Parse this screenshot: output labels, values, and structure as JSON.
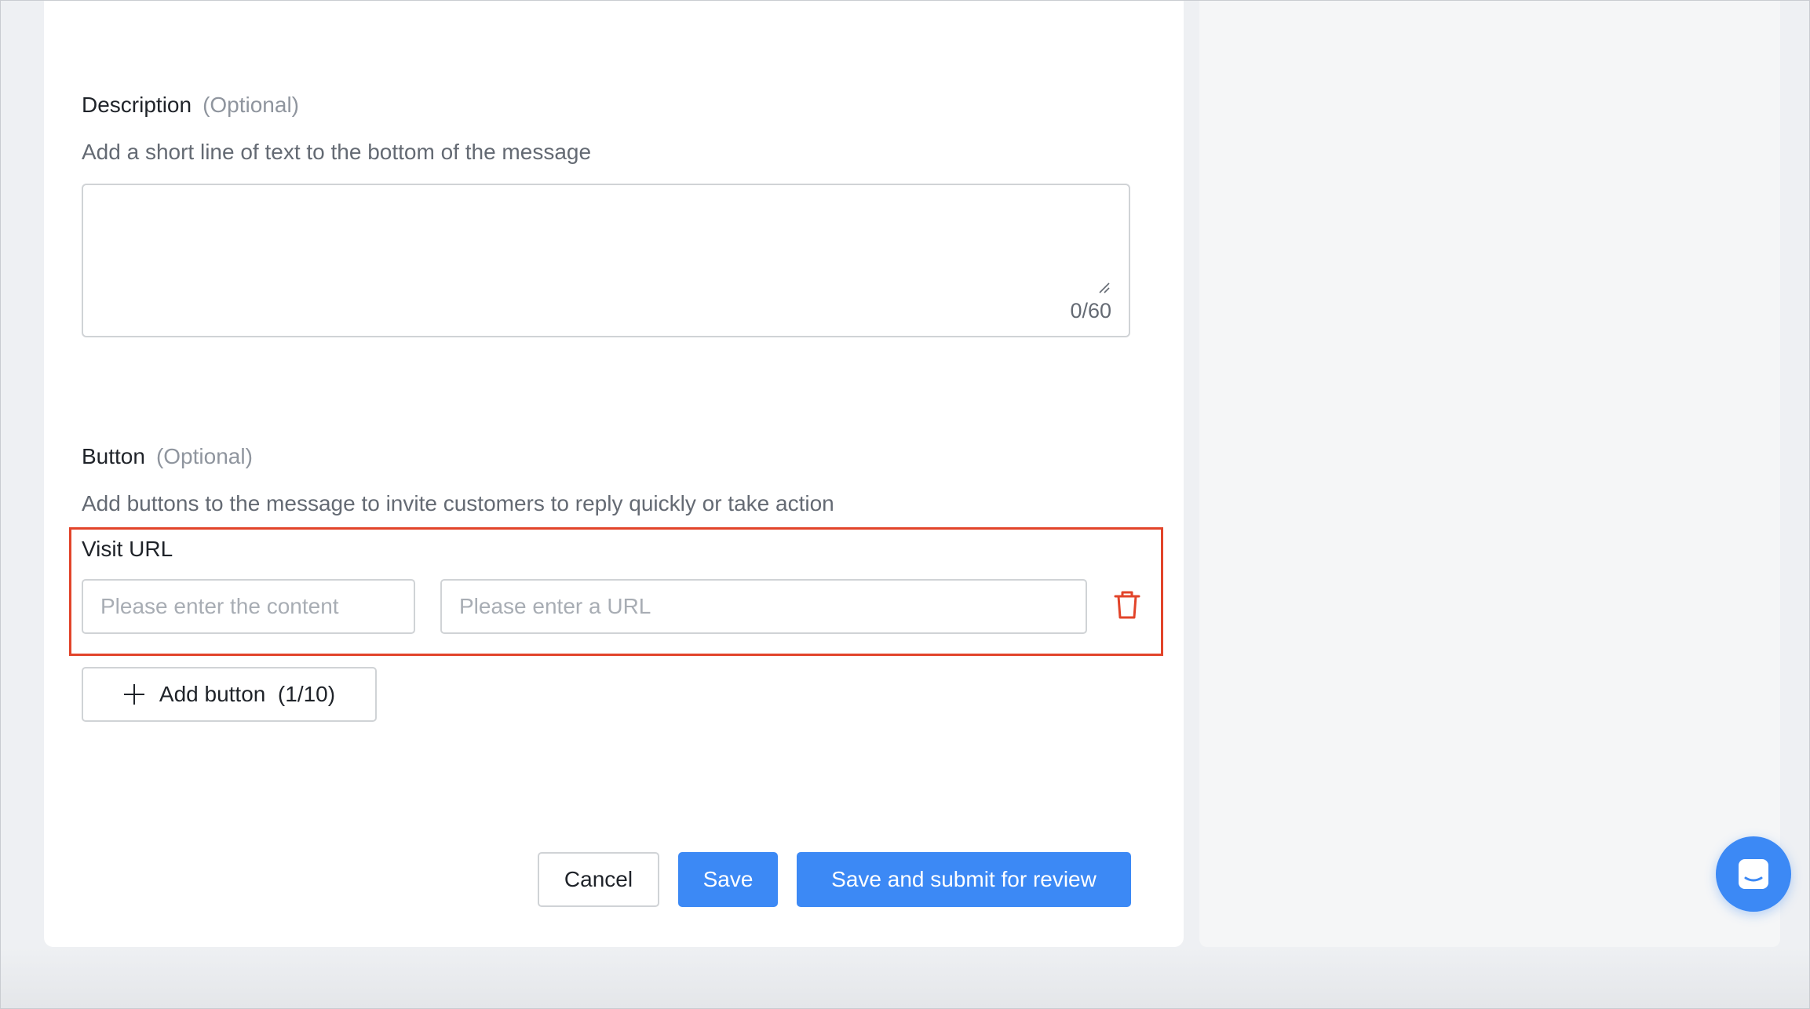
{
  "description_section": {
    "title": "Description",
    "optional": "(Optional)",
    "hint": "Add a short line of text to the bottom of the message",
    "counter": "0/60"
  },
  "button_section": {
    "title": "Button",
    "optional": "(Optional)",
    "hint": "Add buttons to the message to invite customers to reply quickly or take action",
    "button_type_label": "Visit URL",
    "content_placeholder": "Please enter the content",
    "url_placeholder": "Please enter a URL",
    "delete_icon": "trash-icon",
    "add_button_label": "Add button",
    "add_button_count": "(1/10)"
  },
  "footer": {
    "cancel_label": "Cancel",
    "save_label": "Save",
    "submit_label": "Save and submit for review"
  },
  "colors": {
    "primary": "#3c89f5",
    "highlight": "#e2442a",
    "danger_icon": "#e2442a"
  },
  "chat_launcher_icon": "chat-bubble-icon"
}
